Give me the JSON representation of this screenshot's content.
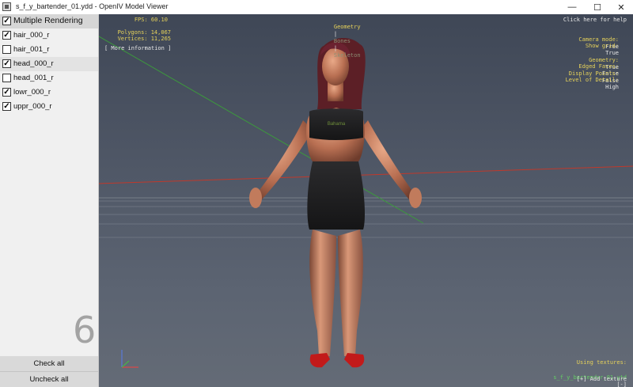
{
  "window": {
    "title": "s_f_y_bartender_01.ydd - OpenIV Model Viewer",
    "min_glyph": "—",
    "max_glyph": "☐",
    "close_glyph": "✕"
  },
  "sidebar": {
    "header_label": "Multiple Rendering",
    "items": [
      {
        "label": "hair_000_r",
        "checked": true
      },
      {
        "label": "hair_001_r",
        "checked": false
      },
      {
        "label": "head_000_r",
        "checked": true
      },
      {
        "label": "head_001_r",
        "checked": false
      },
      {
        "label": "lowr_000_r",
        "checked": true
      },
      {
        "label": "uppr_000_r",
        "checked": true
      }
    ],
    "count": "6",
    "check_all": "Check all",
    "uncheck_all": "Uncheck all"
  },
  "viewport": {
    "fps": "FPS: 60.10",
    "polygons": "Polygons: 14,067",
    "vertices": "Vertices: 11,265",
    "more_info": "[ More information ]",
    "mode_geometry": "Geometry",
    "mode_sep1": "|",
    "mode_mid": "Bones",
    "mode_sep2": "|",
    "mode_last": "Skeleton",
    "help": "Click here for help",
    "camera_label": "Camera mode:",
    "camera_value": "Free",
    "grid_label": "Show grid:",
    "grid_value": "True",
    "geometry_label": "Geometry:",
    "geometry_value": "True",
    "edged_label": "Edged Faces:",
    "edged_value": "False",
    "points_label": "Display Points:",
    "points_value": "False",
    "lod_label": "Level of Detail:",
    "lod_value": "High",
    "textures_label": "Using textures:",
    "texture_file": "s_f_y_bartender_01.ytd",
    "texture_toggle": "[-]",
    "add_texture": "[+] Add texture",
    "shirt_text": "Bahama"
  },
  "colors": {
    "hud_yellow": "#e6d25a",
    "hud_green": "#64d064",
    "hud_white": "#e8e8e8",
    "axis_red": "#c0392b",
    "axis_green": "#3c9a3c"
  }
}
